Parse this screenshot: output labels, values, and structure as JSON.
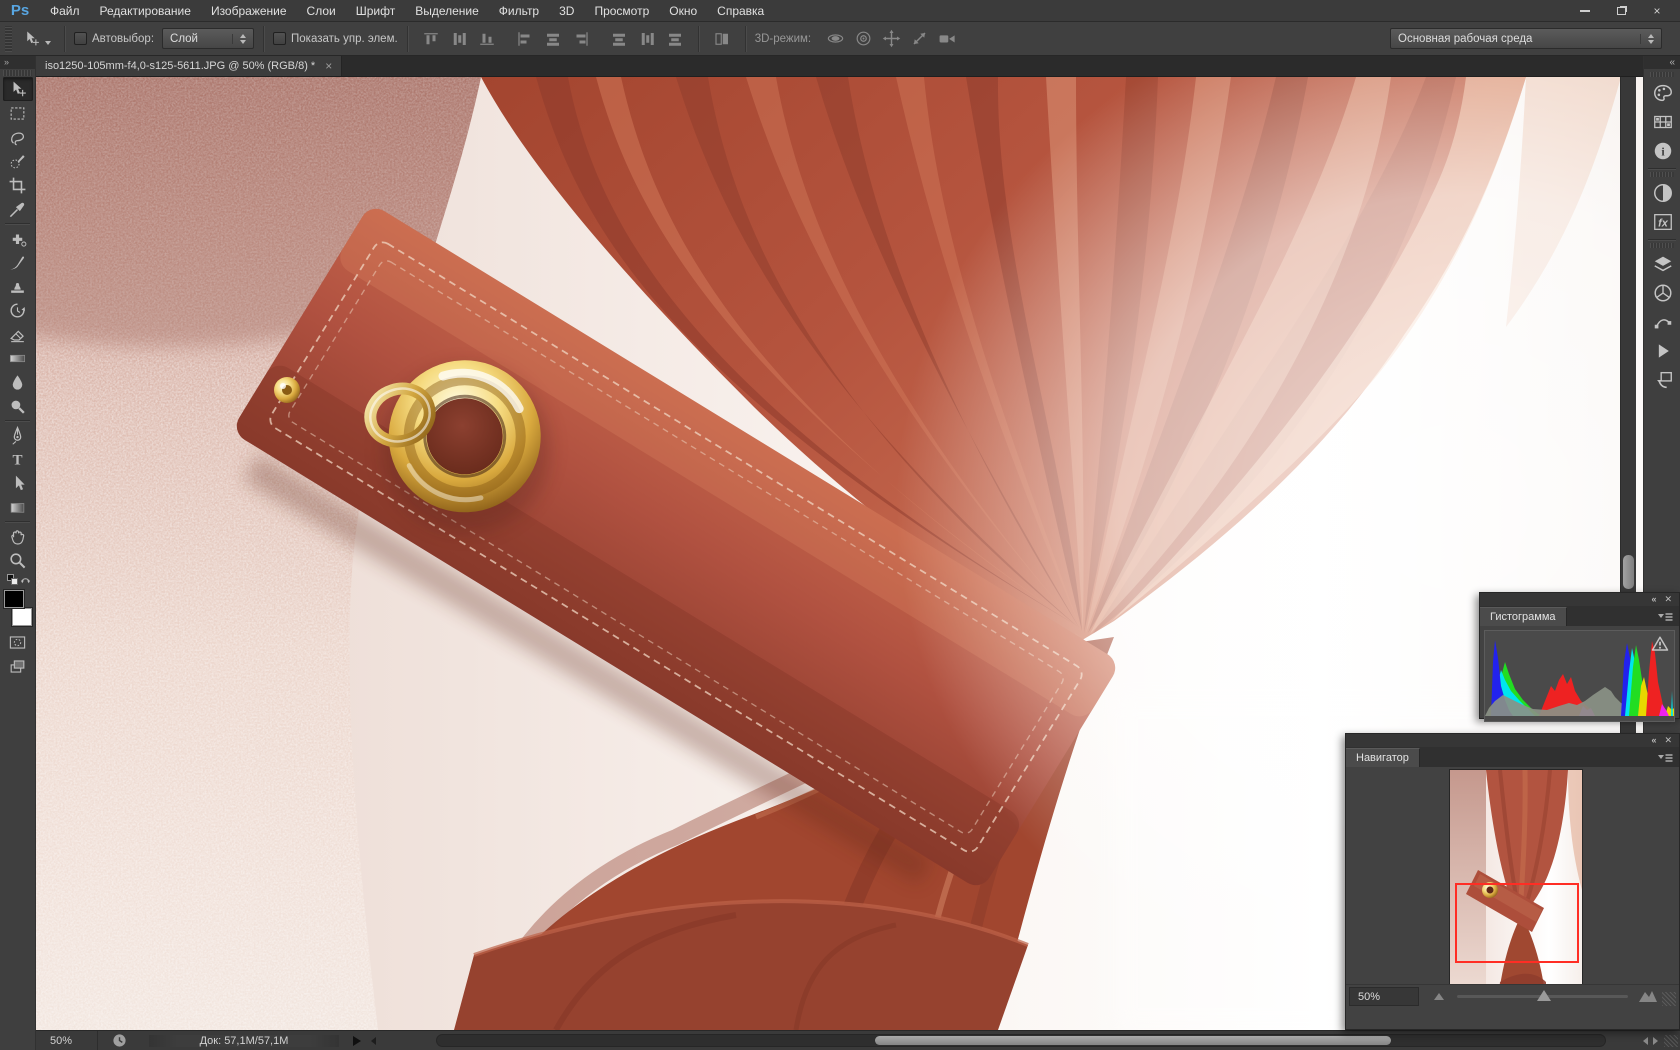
{
  "colors": {
    "workspace_bg": "#3f3f3f",
    "viewbox_red": "#ff2d24",
    "logo_blue": "#58a6e2",
    "curtain_rust": "#b5543e",
    "gold": "#d9a93e"
  },
  "menu_bar": {
    "logo": "Ps",
    "items": [
      "Файл",
      "Редактирование",
      "Изображение",
      "Слои",
      "Шрифт",
      "Выделение",
      "Фильтр",
      "3D",
      "Просмотр",
      "Окно",
      "Справка"
    ]
  },
  "window_controls": {
    "close_glyph": "×"
  },
  "options_bar": {
    "autoselect_label": "Автовыбор:",
    "layer_value": "Слой",
    "show_controls_label": "Показать упр. элем.",
    "mode3d_label": "3D-режим:",
    "workspace_value": "Основная рабочая среда"
  },
  "document_tab": {
    "title": "iso1250-105mm-f4,0-s125-5611.JPG @ 50%  (RGB/8) *",
    "close_glyph": "×"
  },
  "toolbar": {
    "expand_glyph": "»",
    "selected_tool": "move",
    "tools": [
      "move",
      "rectangular-marquee",
      "lasso",
      "quick-selection",
      "crop",
      "eyedropper",
      "spot-healing-brush",
      "brush",
      "clone-stamp",
      "history-brush",
      "eraser",
      "gradient",
      "blur",
      "dodge",
      "pen",
      "horizontal-type",
      "path-selection",
      "rectangle",
      "hand",
      "zoom"
    ]
  },
  "dock": {
    "collapse_glyph": "«",
    "icons": [
      "color",
      "swatches",
      "info",
      "adjustments",
      "styles",
      "layers",
      "channels",
      "paths",
      "actions",
      "history"
    ]
  },
  "panels": {
    "histogram": {
      "title": "Гистограмма",
      "collapse_glyph": "«",
      "close_glyph": "✕"
    },
    "navigator": {
      "title": "Навигатор",
      "zoom": "50%",
      "collapse_glyph": "«",
      "close_glyph": "✕"
    }
  },
  "status_bar": {
    "zoom": "50%",
    "doc_info": "Док: 57,1M/57,1M"
  }
}
